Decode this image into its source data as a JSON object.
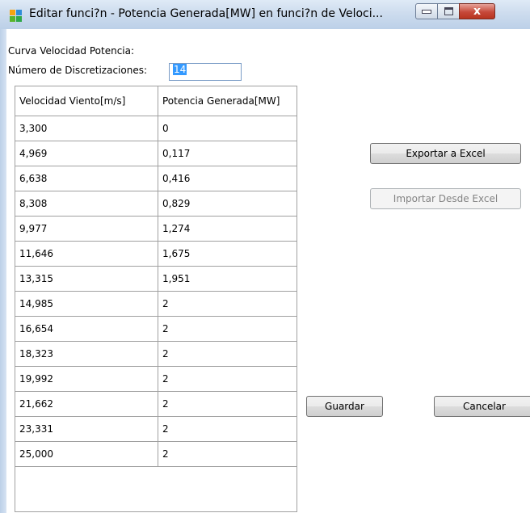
{
  "window": {
    "title": "Editar funci?n - Potencia Generada[MW] en funci?n de Veloci...",
    "close_glyph": "x"
  },
  "form": {
    "curve_label": "Curva Velocidad Potencia:",
    "discretizations_label": "Número de Discretizaciones:",
    "discretizations_value": "14"
  },
  "grid": {
    "headers": [
      "Velocidad Viento[m/s]",
      "Potencia Generada[MW]"
    ],
    "rows": [
      [
        "3,300",
        "0"
      ],
      [
        "4,969",
        "0,117"
      ],
      [
        "6,638",
        "0,416"
      ],
      [
        "8,308",
        "0,829"
      ],
      [
        "9,977",
        "1,274"
      ],
      [
        "11,646",
        "1,675"
      ],
      [
        "13,315",
        "1,951"
      ],
      [
        "14,985",
        "2"
      ],
      [
        "16,654",
        "2"
      ],
      [
        "18,323",
        "2"
      ],
      [
        "19,992",
        "2"
      ],
      [
        "21,662",
        "2"
      ],
      [
        "23,331",
        "2"
      ],
      [
        "25,000",
        "2"
      ]
    ]
  },
  "buttons": {
    "export": "Exportar a Excel",
    "import": "Importar Desde Excel",
    "save": "Guardar",
    "cancel": "Cancelar"
  },
  "icons": {
    "app": "app-tiles-icon",
    "minimize": "minimize-icon",
    "maximize": "maximize-icon",
    "close": "close-icon"
  },
  "colors": {
    "titlebar": "#cddcee",
    "close_button": "#c6493a",
    "selection": "#3399ff",
    "disabled_text": "#838383"
  }
}
